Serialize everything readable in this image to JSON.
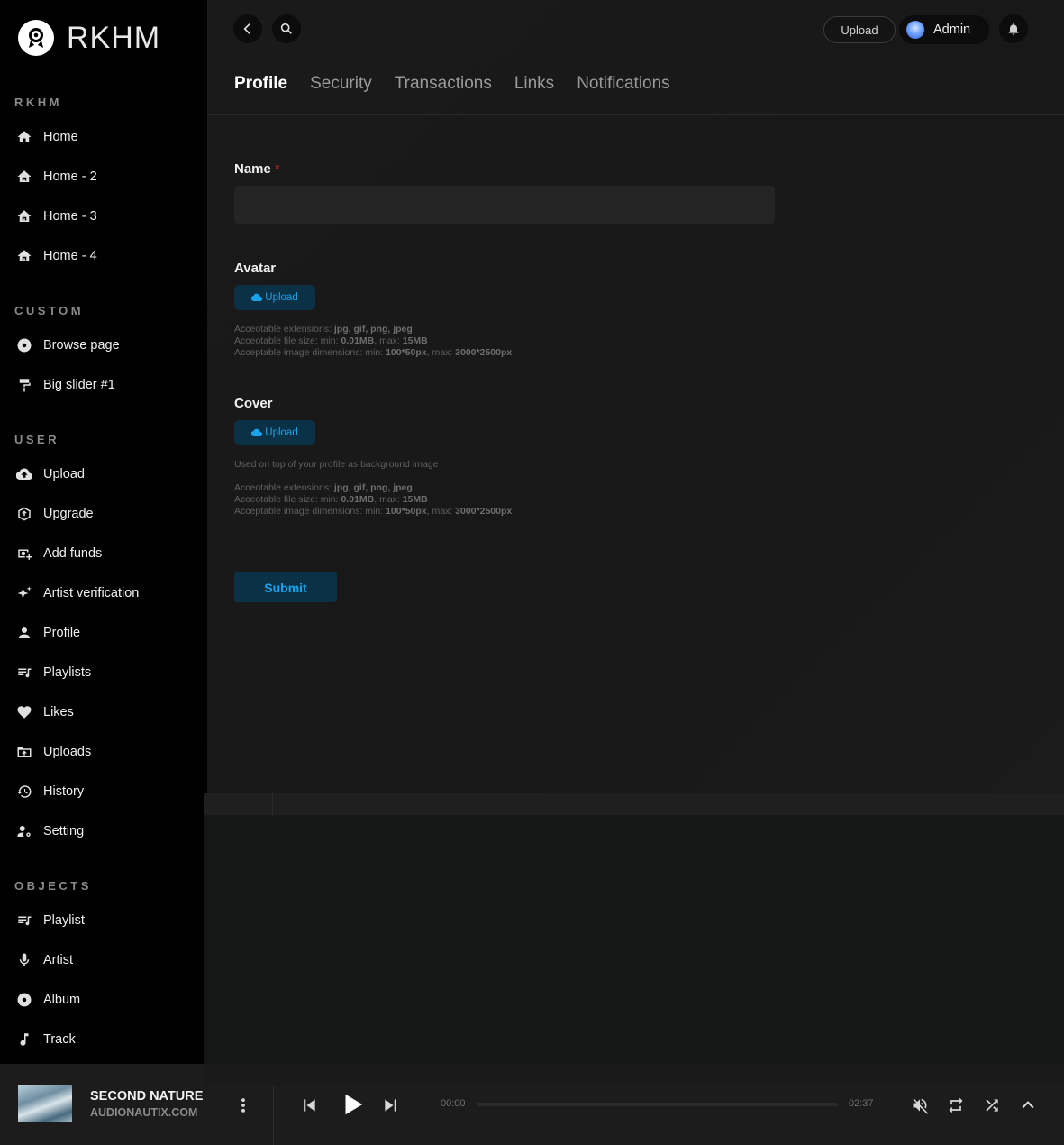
{
  "app": {
    "logo_text": "RKHM"
  },
  "sidebar": {
    "sections": [
      {
        "title": "RKHM"
      },
      {
        "title": "CUSTOM"
      },
      {
        "title": "USER"
      },
      {
        "title": "OBJECTS"
      }
    ],
    "rkhm_items": [
      {
        "label": "Home",
        "icon": "home-icon"
      },
      {
        "label": "Home - 2",
        "icon": "home-variant-icon"
      },
      {
        "label": "Home - 3",
        "icon": "home-variant-icon"
      },
      {
        "label": "Home - 4",
        "icon": "home-variant-icon"
      }
    ],
    "custom_items": [
      {
        "label": "Browse page",
        "icon": "disc-icon"
      },
      {
        "label": "Big slider #1",
        "icon": "paint-roller-icon"
      }
    ],
    "user_items": [
      {
        "label": "Upload",
        "icon": "cloud-upload-icon"
      },
      {
        "label": "Upgrade",
        "icon": "upgrade-icon"
      },
      {
        "label": "Add funds",
        "icon": "add-funds-icon"
      },
      {
        "label": "Artist verification",
        "icon": "sparkle-icon"
      },
      {
        "label": "Profile",
        "icon": "user-icon"
      },
      {
        "label": "Playlists",
        "icon": "playlist-icon"
      },
      {
        "label": "Likes",
        "icon": "heart-icon"
      },
      {
        "label": "Uploads",
        "icon": "folder-upload-icon"
      },
      {
        "label": "History",
        "icon": "history-icon"
      },
      {
        "label": "Setting",
        "icon": "user-settings-icon"
      }
    ],
    "objects_items": [
      {
        "label": "Playlist",
        "icon": "playlist-icon"
      },
      {
        "label": "Artist",
        "icon": "microphone-icon"
      },
      {
        "label": "Album",
        "icon": "disc-icon"
      },
      {
        "label": "Track",
        "icon": "music-note-icon"
      }
    ]
  },
  "topbar": {
    "upload_label": "Upload",
    "admin_label": "Admin"
  },
  "tabs": [
    {
      "label": "Profile",
      "active": true
    },
    {
      "label": "Security",
      "active": false
    },
    {
      "label": "Transactions",
      "active": false
    },
    {
      "label": "Links",
      "active": false
    },
    {
      "label": "Notifications",
      "active": false
    }
  ],
  "form": {
    "name_label": "Name",
    "name_required_mark": "*",
    "name_value": "",
    "avatar_label": "Avatar",
    "avatar_upload_label": "Upload",
    "avatar_hint": {
      "ext_prefix": "Acceotable extensions: ",
      "ext_values": "jpg, gif, png, jpeg",
      "size_prefix": "Acceotable file size: min: ",
      "size_min": "0.01MB",
      "size_mid": ", max: ",
      "size_max": "15MB",
      "dim_prefix": "Acceptable image dimensions: min: ",
      "dim_min": "100*50px",
      "dim_mid": ", max: ",
      "dim_max": "3000*2500px"
    },
    "cover_label": "Cover",
    "cover_upload_label": "Upload",
    "cover_desc": "Used on top of your profile as background image",
    "cover_hint": {
      "ext_prefix": "Acceotable extensions: ",
      "ext_values": "jpg, gif, png, jpeg",
      "size_prefix": "Acceotable file size: min: ",
      "size_min": "0.01MB",
      "size_mid": ", max: ",
      "size_max": "15MB",
      "dim_prefix": "Acceptable image dimensions: min: ",
      "dim_min": "100*50px",
      "dim_mid": ", max: ",
      "dim_max": "3000*2500px"
    },
    "submit_label": "Submit"
  },
  "player": {
    "track_title": "SECOND NATURE",
    "track_artist": "AUDIONAUTIX.COM",
    "time_current": "00:00",
    "time_total": "02:37",
    "progress": 0
  },
  "colors": {
    "accent": "#1aa3ea",
    "accent_bg": "#0b3146",
    "sidebar_bg": "#000000",
    "main_bg": "#1a1a1a"
  }
}
